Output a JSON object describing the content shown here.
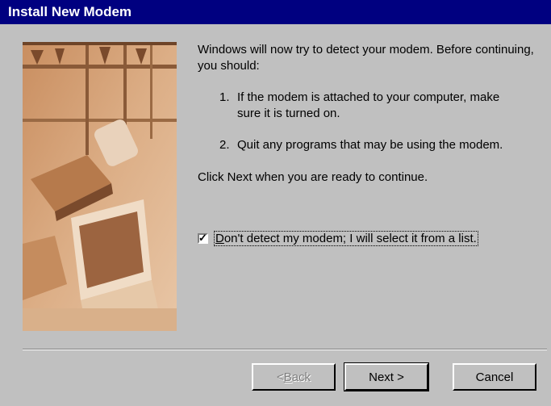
{
  "window": {
    "title": "Install New Modem"
  },
  "intro": "Windows will now try to detect your modem.  Before continuing, you should:",
  "steps": [
    {
      "num": "1.",
      "text": "If the modem is attached to your computer, make sure it is turned on."
    },
    {
      "num": "2.",
      "text": "Quit any programs that may be using the modem."
    }
  ],
  "continue_text": "Click Next when you are ready to continue.",
  "checkbox": {
    "checked": true,
    "label_first": "D",
    "label_rest": "on't detect my modem; I will select it from a list."
  },
  "buttons": {
    "back_prefix": "< ",
    "back_key": "B",
    "back_rest": "ack",
    "next": "Next >",
    "cancel": "Cancel"
  },
  "colors": {
    "titlebar": "#000080",
    "dialog": "#c0c0c0",
    "image_tone": "#d7a47a"
  }
}
